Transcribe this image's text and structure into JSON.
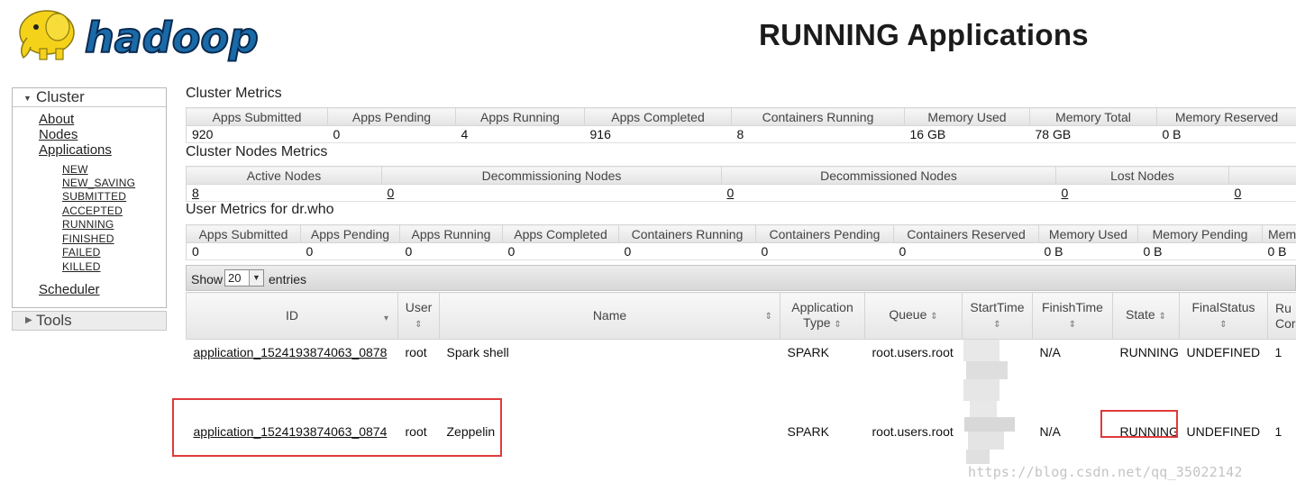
{
  "header": {
    "logo_text": "hadoop",
    "title": "RUNNING Applications"
  },
  "sidebar": {
    "cluster_label": "Cluster",
    "links": {
      "about": "About",
      "nodes": "Nodes",
      "applications": "Applications",
      "scheduler": "Scheduler"
    },
    "app_states": [
      "NEW",
      "NEW_SAVING",
      "SUBMITTED",
      "ACCEPTED",
      "RUNNING",
      "FINISHED",
      "FAILED",
      "KILLED"
    ],
    "tools_label": "Tools"
  },
  "cluster_metrics": {
    "title": "Cluster Metrics",
    "headers": [
      "Apps Submitted",
      "Apps Pending",
      "Apps Running",
      "Apps Completed",
      "Containers Running",
      "Memory Used",
      "Memory Total",
      "Memory Reserved"
    ],
    "values": [
      "920",
      "0",
      "4",
      "916",
      "8",
      "16 GB",
      "78 GB",
      "0 B"
    ]
  },
  "node_metrics": {
    "title": "Cluster Nodes Metrics",
    "headers": [
      "Active Nodes",
      "Decommissioning Nodes",
      "Decommissioned Nodes",
      "Lost Nodes",
      ""
    ],
    "values": [
      "8",
      "0",
      "0",
      "0",
      "0"
    ]
  },
  "user_metrics": {
    "title": "User Metrics for dr.who",
    "headers": [
      "Apps Submitted",
      "Apps Pending",
      "Apps Running",
      "Apps Completed",
      "Containers Running",
      "Containers Pending",
      "Containers Reserved",
      "Memory Used",
      "Memory Pending",
      "Memo"
    ],
    "values": [
      "0",
      "0",
      "0",
      "0",
      "0",
      "0",
      "0",
      "0 B",
      "0 B",
      "0 B"
    ]
  },
  "table_controls": {
    "show_label": "Show",
    "entries_value": "20",
    "entries_label": "entries"
  },
  "apps_table": {
    "headers": {
      "id": "ID",
      "user": "User",
      "name": "Name",
      "app_type_1": "Application",
      "app_type_2": "Type",
      "queue": "Queue",
      "start": "StartTime",
      "finish": "FinishTime",
      "state": "State",
      "final": "FinalStatus",
      "running_1": "Ru",
      "running_2": "Cor"
    },
    "rows": [
      {
        "id": "application_1524193874063_0878",
        "user": "root",
        "name": "Spark shell",
        "type": "SPARK",
        "queue": "root.users.root",
        "start": "",
        "finish": "N/A",
        "state": "RUNNING",
        "final": "UNDEFINED",
        "running": "1"
      },
      {
        "id": "application_1524193874063_0874",
        "user": "root",
        "name": "Zeppelin",
        "type": "SPARK",
        "queue": "root.users.root",
        "start": "",
        "finish": "N/A",
        "state": "RUNNING",
        "final": "UNDEFINED",
        "running": "1"
      }
    ]
  },
  "watermark": "https://blog.csdn.net/qq_35022142",
  "colors": {
    "highlight": "#e03a3a",
    "logo_yellow": "#f5d21a",
    "logo_blue": "#1a6aa8"
  }
}
